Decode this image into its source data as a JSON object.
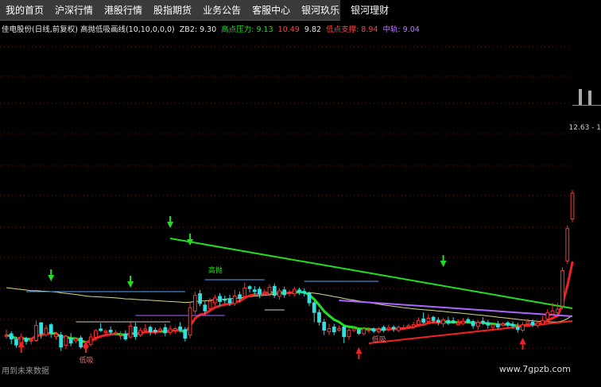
{
  "menu": [
    "我的首页",
    "沪深行情",
    "港股行情",
    "股指期货",
    "业务公告",
    "客服中心",
    "银河玖乐",
    "银河理财"
  ],
  "indicator": {
    "name": "佳电股份(日线,前复权) 高抛低吸画线(10,10,0,0,0)",
    "zb2_label": "ZB2:",
    "zb2_value": "9.30",
    "high_label": "高点压力:",
    "high_v1": "9.13",
    "high_v2": "10.49",
    "high_v3": "9.82",
    "low_label": "低点支撑:",
    "low_value": "8.94",
    "mid_label": "中轨:",
    "mid_value": "9.04"
  },
  "price_label": "12.63 - 1",
  "markers": {
    "high": "高抛",
    "low": "低吸"
  },
  "footer_note": "用到未来数据",
  "watermark": "www.7gpzb.com",
  "colors": {
    "up": "#ff3030",
    "down": "#30e0e0",
    "resistance": "#22dd22",
    "support": "#ee2222",
    "mid_purple": "#aa66ff",
    "long_ma": "#d8d888"
  },
  "chart_data": {
    "type": "candlestick",
    "candles": [
      [
        10.16,
        10.19,
        10.37,
        10.08
      ],
      [
        10.24,
        10.08,
        10.32,
        9.92
      ],
      [
        10.06,
        9.89,
        10.15,
        9.81
      ],
      [
        9.89,
        10.14,
        10.25,
        9.8
      ],
      [
        10.09,
        10.0,
        10.15,
        9.9
      ],
      [
        10.01,
        10.04,
        10.11,
        9.91
      ],
      [
        10.03,
        10.5,
        10.65,
        9.99
      ],
      [
        10.58,
        10.24,
        10.6,
        10.09
      ],
      [
        10.21,
        10.41,
        10.51,
        10.15
      ],
      [
        10.52,
        10.26,
        10.57,
        10.12
      ],
      [
        10.15,
        10.23,
        10.3,
        10.06
      ],
      [
        10.2,
        9.83,
        10.29,
        9.71
      ],
      [
        9.88,
        10.16,
        10.21,
        9.77
      ],
      [
        10.1,
        9.95,
        10.26,
        9.85
      ],
      [
        10.02,
        10.08,
        10.13,
        9.94
      ],
      [
        10.11,
        9.83,
        10.18,
        9.77
      ],
      [
        9.79,
        9.82,
        9.92,
        9.72
      ],
      [
        9.91,
        10.14,
        10.25,
        9.85
      ],
      [
        10.13,
        10.34,
        10.38,
        10.03
      ],
      [
        10.39,
        10.34,
        10.57,
        10.3
      ],
      [
        10.28,
        10.32,
        10.38,
        10.21
      ],
      [
        10.35,
        10.29,
        10.47,
        10.22
      ],
      [
        10.24,
        10.27,
        10.36,
        10.18
      ],
      [
        10.2,
        10.2,
        10.32,
        10.06
      ],
      [
        10.24,
        10.08,
        10.35,
        10.02
      ],
      [
        10.14,
        10.48,
        10.6,
        10.09
      ],
      [
        10.45,
        10.15,
        10.58,
        10.06
      ],
      [
        10.2,
        10.34,
        10.43,
        10.14
      ],
      [
        10.34,
        10.39,
        10.54,
        10.3
      ],
      [
        10.44,
        10.3,
        10.5,
        10.19
      ],
      [
        10.35,
        10.3,
        10.43,
        10.22
      ],
      [
        10.33,
        10.38,
        10.45,
        10.26
      ],
      [
        10.43,
        10.27,
        10.55,
        10.16
      ],
      [
        10.28,
        10.39,
        10.5,
        10.2
      ],
      [
        10.35,
        10.4,
        10.45,
        10.25
      ],
      [
        10.45,
        10.37,
        10.6,
        10.28
      ],
      [
        10.37,
        10.1,
        10.45,
        10.0
      ],
      [
        10.2,
        11.05,
        11.2,
        10.1
      ],
      [
        10.94,
        11.43,
        11.55,
        10.84
      ],
      [
        11.48,
        11.18,
        11.6,
        11.1
      ],
      [
        11.13,
        10.95,
        11.25,
        10.85
      ],
      [
        11.02,
        11.25,
        11.35,
        10.95
      ],
      [
        11.2,
        11.35,
        11.45,
        11.1
      ],
      [
        11.4,
        11.24,
        11.5,
        11.1
      ],
      [
        11.3,
        11.29,
        11.42,
        11.18
      ],
      [
        11.33,
        11.2,
        11.45,
        11.1
      ],
      [
        11.18,
        11.41,
        11.6,
        11.1
      ],
      [
        11.45,
        11.33,
        11.55,
        11.22
      ],
      [
        11.4,
        11.66,
        11.83,
        11.35
      ],
      [
        11.7,
        11.64,
        11.75,
        11.52
      ],
      [
        11.6,
        11.55,
        11.72,
        11.45
      ],
      [
        11.62,
        11.47,
        11.7,
        11.35
      ],
      [
        11.5,
        11.54,
        11.62,
        11.42
      ],
      [
        11.48,
        11.68,
        11.78,
        11.4
      ],
      [
        11.71,
        11.43,
        11.8,
        11.35
      ],
      [
        11.4,
        11.57,
        11.65,
        11.3
      ],
      [
        11.6,
        11.45,
        11.7,
        11.35
      ],
      [
        11.5,
        11.52,
        11.6,
        11.4
      ],
      [
        11.48,
        11.62,
        11.7,
        11.4
      ],
      [
        11.6,
        11.53,
        11.67,
        11.45
      ],
      [
        11.55,
        11.5,
        11.65,
        11.4
      ],
      [
        11.5,
        11.2,
        11.55,
        11.1
      ],
      [
        11.2,
        10.9,
        11.25,
        10.6
      ],
      [
        10.9,
        10.6,
        11.0,
        10.5
      ],
      [
        10.6,
        10.35,
        10.7,
        10.2
      ],
      [
        10.3,
        10.4,
        10.55,
        10.2
      ],
      [
        10.45,
        10.3,
        10.55,
        10.2
      ],
      [
        10.35,
        10.4,
        10.5,
        10.3
      ],
      [
        10.45,
        10.15,
        10.5,
        9.95
      ],
      [
        10.15,
        10.35,
        10.42,
        10.05
      ],
      [
        10.34,
        10.39,
        10.45,
        10.3
      ],
      [
        10.36,
        10.25,
        10.42,
        10.2
      ],
      [
        10.24,
        10.39,
        10.45,
        10.18
      ],
      [
        10.35,
        10.36,
        10.44,
        10.26
      ],
      [
        10.39,
        10.32,
        10.43,
        10.26
      ],
      [
        10.3,
        10.38,
        10.45,
        10.25
      ],
      [
        10.44,
        10.35,
        10.5,
        10.28
      ],
      [
        10.38,
        10.43,
        10.52,
        10.31
      ],
      [
        10.44,
        10.39,
        10.5,
        10.3
      ],
      [
        10.34,
        10.44,
        10.5,
        10.29
      ],
      [
        10.41,
        10.42,
        10.52,
        10.36
      ],
      [
        10.45,
        10.49,
        10.55,
        10.4
      ],
      [
        10.46,
        10.52,
        10.61,
        10.4
      ],
      [
        10.53,
        10.65,
        10.75,
        10.5
      ],
      [
        10.7,
        10.6,
        10.9,
        10.55
      ],
      [
        10.62,
        10.72,
        10.85,
        10.55
      ],
      [
        10.75,
        10.65,
        10.8,
        10.58
      ],
      [
        10.66,
        10.6,
        10.75,
        10.5
      ],
      [
        10.55,
        10.67,
        10.74,
        10.45
      ],
      [
        10.65,
        10.57,
        10.77,
        10.51
      ],
      [
        10.64,
        10.59,
        10.75,
        10.55
      ],
      [
        10.52,
        10.57,
        10.68,
        10.5
      ],
      [
        10.56,
        10.63,
        10.73,
        10.5
      ],
      [
        10.68,
        10.6,
        10.75,
        10.57
      ],
      [
        10.62,
        10.49,
        10.67,
        10.4
      ],
      [
        10.47,
        10.59,
        10.66,
        10.36
      ],
      [
        10.63,
        10.58,
        10.75,
        10.51
      ],
      [
        10.58,
        10.51,
        10.67,
        10.4
      ],
      [
        10.44,
        10.51,
        10.55,
        10.32
      ],
      [
        10.54,
        10.45,
        10.64,
        10.39
      ],
      [
        10.51,
        10.55,
        10.6,
        10.47
      ],
      [
        10.58,
        10.52,
        10.63,
        10.44
      ],
      [
        10.53,
        10.48,
        10.62,
        10.39
      ],
      [
        10.45,
        10.37,
        10.58,
        10.27
      ],
      [
        10.35,
        10.52,
        10.6,
        10.3
      ],
      [
        10.55,
        10.61,
        10.7,
        10.5
      ],
      [
        10.6,
        10.52,
        10.68,
        10.45
      ],
      [
        10.5,
        10.58,
        10.63,
        10.43
      ],
      [
        10.54,
        10.65,
        10.78,
        10.52
      ],
      [
        10.7,
        10.9,
        11.0,
        10.6
      ],
      [
        10.85,
        10.95,
        11.2,
        10.8
      ],
      [
        10.9,
        11.0,
        11.2,
        10.85
      ],
      [
        11.1,
        12.2,
        12.3,
        11.0
      ],
      [
        12.5,
        13.5,
        13.6,
        12.4
      ],
      [
        13.8,
        14.6,
        14.7,
        13.7
      ]
    ]
  }
}
